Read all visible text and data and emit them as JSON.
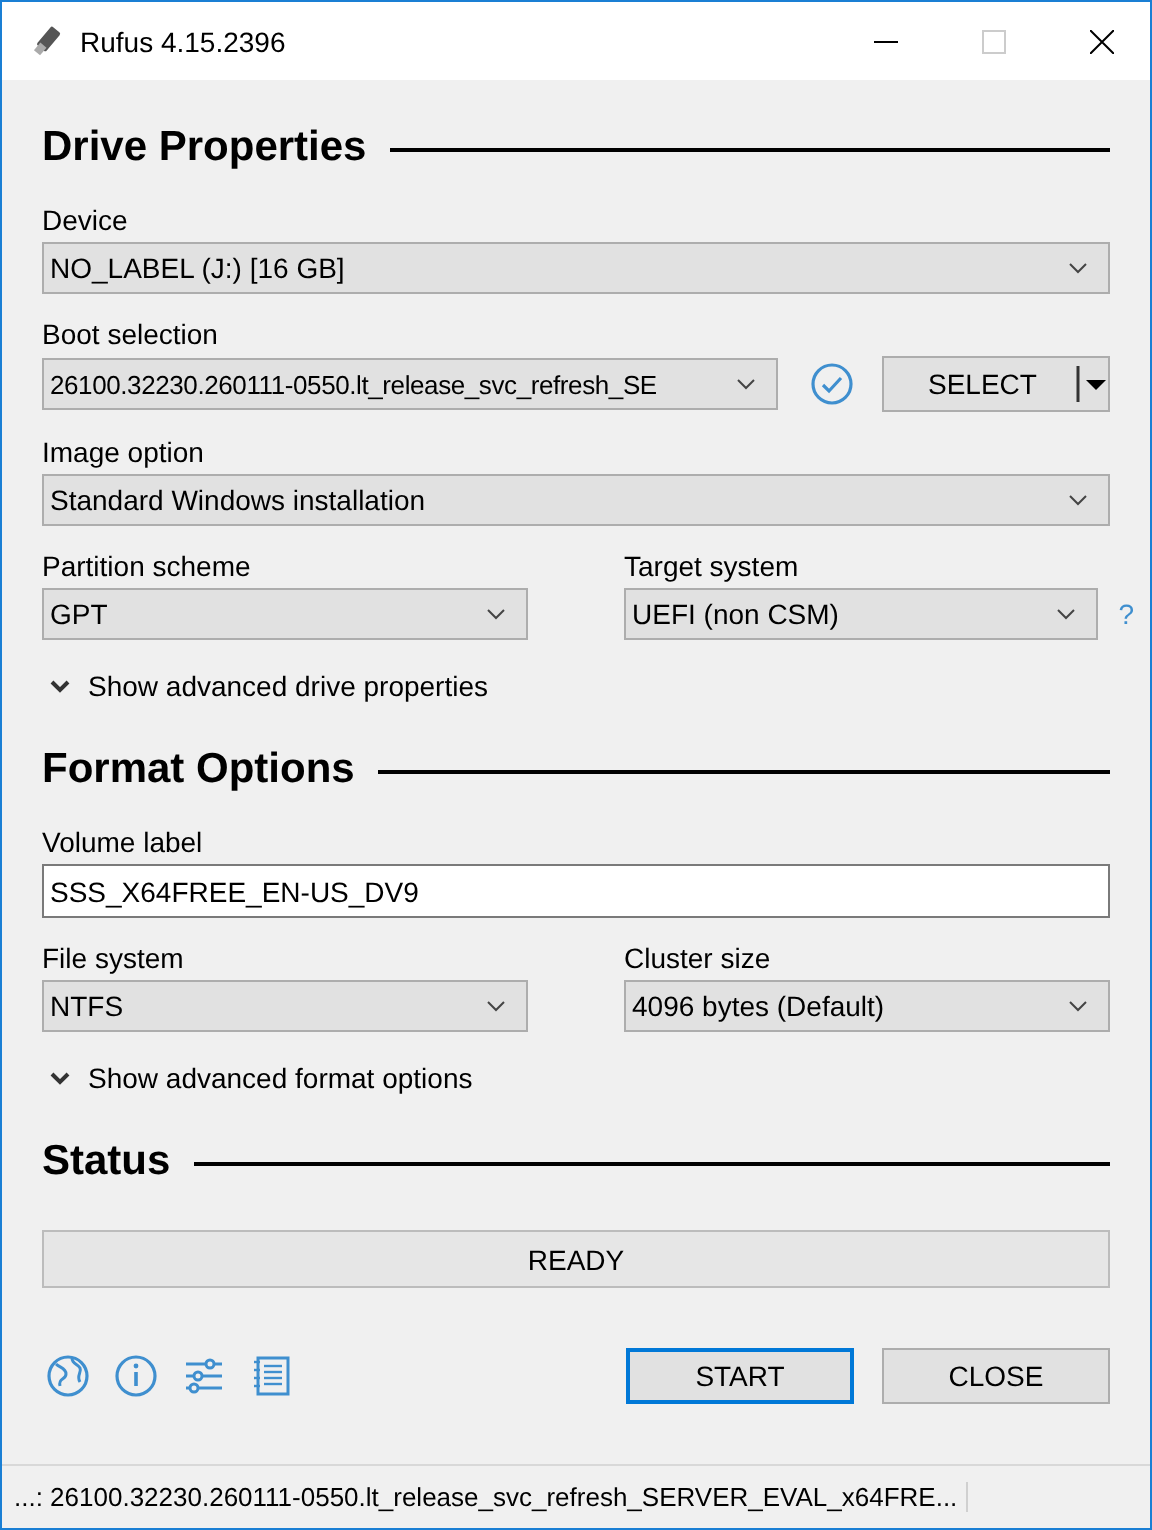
{
  "window": {
    "title": "Rufus 4.15.2396"
  },
  "drive_properties": {
    "heading": "Drive Properties",
    "device": {
      "label": "Device",
      "value": "NO_LABEL (J:) [16 GB]"
    },
    "boot_selection": {
      "label": "Boot selection",
      "value": "26100.32230.260111-0550.lt_release_svc_refresh_SE",
      "button": "SELECT"
    },
    "image_option": {
      "label": "Image option",
      "value": "Standard Windows installation"
    },
    "partition_scheme": {
      "label": "Partition scheme",
      "value": "GPT"
    },
    "target_system": {
      "label": "Target system",
      "value": "UEFI (non CSM)",
      "help": "?"
    },
    "advanced_toggle": {
      "label": "Show advanced drive properties",
      "expanded": false
    }
  },
  "format_options": {
    "heading": "Format Options",
    "volume_label": {
      "label": "Volume label",
      "value": "SSS_X64FREE_EN-US_DV9"
    },
    "file_system": {
      "label": "File system",
      "value": "NTFS"
    },
    "cluster_size": {
      "label": "Cluster size",
      "value": "4096 bytes (Default)"
    },
    "advanced_toggle": {
      "label": "Show advanced format options",
      "expanded": false
    }
  },
  "status": {
    "heading": "Status",
    "progress": {
      "text": "READY"
    }
  },
  "buttons": [
    {
      "label": "START",
      "focused": true
    },
    {
      "label": "CLOSE",
      "focused": false
    }
  ],
  "status_bar": "...: 26100.32230.260111-0550.lt_release_svc_refresh_SERVER_EVAL_x64FRE..."
}
